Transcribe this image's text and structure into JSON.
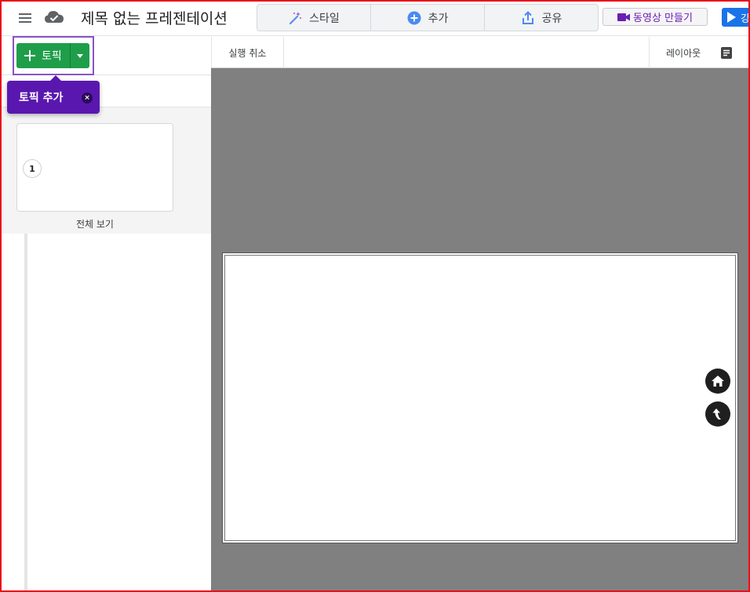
{
  "app": {
    "document_title": "제목 없는 프레젠테이션"
  },
  "toolbar": {
    "style_label": "스타일",
    "add_label": "추가",
    "share_label": "공유",
    "video_label": "동영상 만들기",
    "present_label": "강"
  },
  "left_panel": {
    "topic_button_label": "토픽",
    "tooltip_text": "토픽 추가",
    "tooltip_close": "×",
    "slide_number": "1",
    "overview_label": "전체 보기"
  },
  "main": {
    "undo_label": "실행 취소",
    "layout_label": "레이아웃"
  },
  "colors": {
    "topic_green": "#1f9e4a",
    "tooltip_purple": "#5a17b0",
    "canvas_gray": "#808080",
    "present_blue": "#1a73e8",
    "frame_red": "#e8101a"
  },
  "icons": {
    "menu": "hamburger-menu-icon",
    "cloud": "cloud-saved-icon",
    "style": "magic-wand-icon",
    "add": "plus-circle-icon",
    "share": "share-upload-icon",
    "video": "video-camera-icon",
    "present": "play-icon",
    "home": "home-icon",
    "back": "back-arrow-icon",
    "notes": "notes-icon"
  }
}
